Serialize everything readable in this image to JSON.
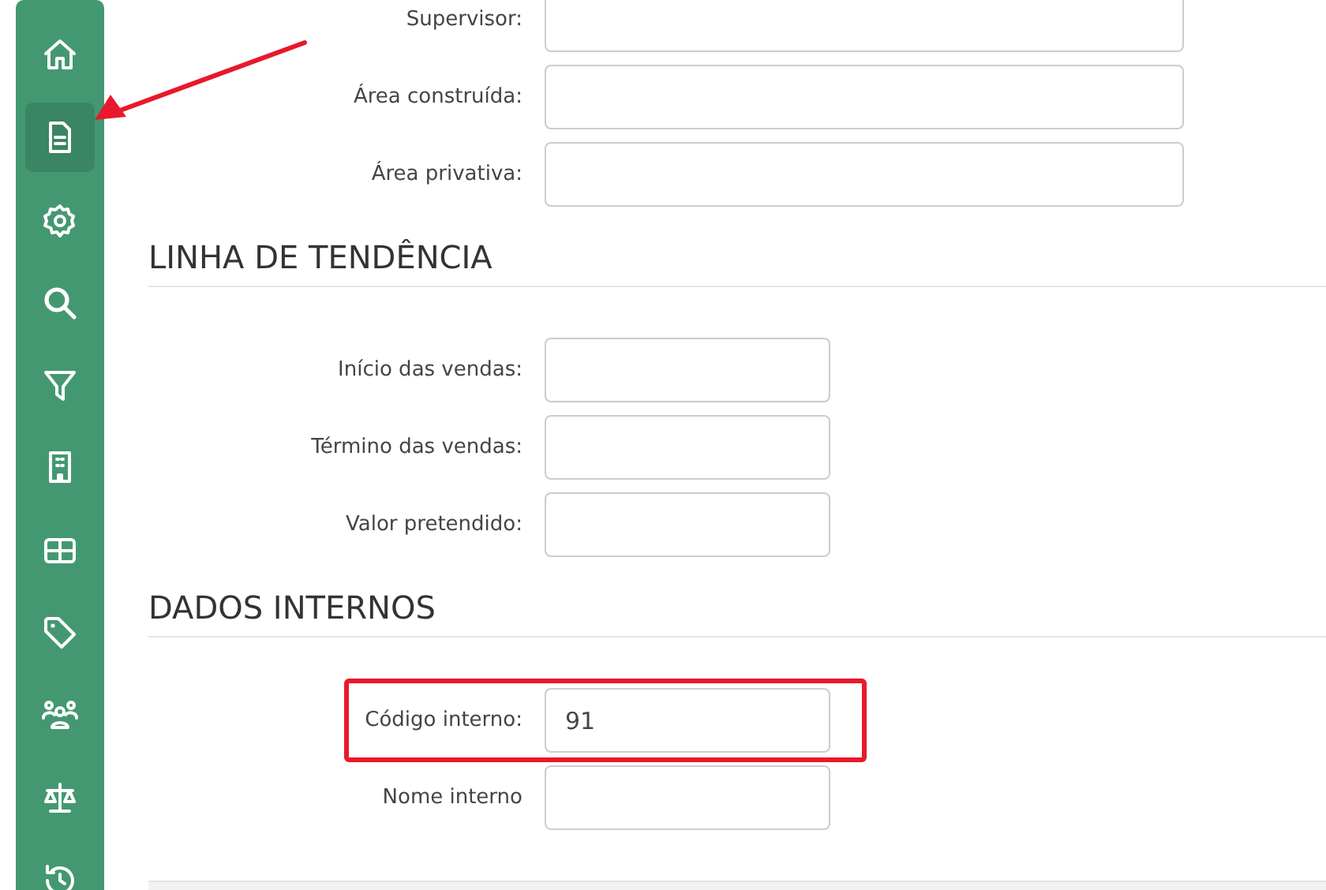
{
  "sidebar": {
    "items": [
      {
        "selected": false
      },
      {
        "selected": true
      },
      {
        "selected": false
      },
      {
        "selected": false
      },
      {
        "selected": false
      },
      {
        "selected": false
      },
      {
        "selected": false
      },
      {
        "selected": false
      },
      {
        "selected": false
      },
      {
        "selected": false
      },
      {
        "selected": false
      }
    ]
  },
  "sections": [
    {
      "kind": "long",
      "fields": [
        {
          "label": "Supervisor:",
          "highlighted": false
        },
        {
          "label": "Área construída:",
          "highlighted": false
        },
        {
          "label": "Área privativa:",
          "highlighted": false
        }
      ]
    },
    {
      "kind": "short",
      "title": "LINHA DE TENDÊNCIA",
      "fields": [
        {
          "label": "Início das vendas:",
          "highlighted": false
        },
        {
          "label": "Término das vendas:",
          "highlighted": false
        },
        {
          "label": "Valor pretendido:",
          "highlighted": false
        }
      ]
    },
    {
      "kind": "short",
      "title": "DADOS INTERNOS",
      "fields": [
        {
          "label": "Código interno:",
          "value": "91",
          "highlighted": true
        },
        {
          "label": "Nome interno",
          "highlighted": false
        }
      ]
    }
  ],
  "annotation": {
    "arrow": true
  }
}
